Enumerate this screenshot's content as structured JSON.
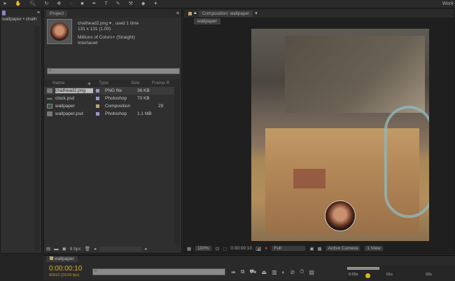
{
  "toolbar": {
    "workspace": "Work"
  },
  "left_panel": {
    "tab": "wallpaper • chath"
  },
  "project": {
    "tab": "Project",
    "info": {
      "name": "chathead2.png ▾ , used 1 time",
      "dims": "131 x 131 (1.00)",
      "colors": "Millions of Colors+ (Straight)",
      "interlace": "Interlaced"
    },
    "search_placeholder": "",
    "columns": {
      "name": "Name",
      "type": "Type",
      "size": "Size",
      "frame": "Frame R"
    },
    "items": [
      {
        "name": "chathead2.png",
        "type": "PNG file",
        "size": "36 KB",
        "frame": ""
      },
      {
        "name": "clock.psd",
        "type": "Photoshop",
        "size": "70 KB",
        "frame": ""
      },
      {
        "name": "wallpaper",
        "type": "Composition",
        "size": "",
        "frame": "29"
      },
      {
        "name": "wallpaper.psd",
        "type": "Photoshop",
        "size": "1.1 MB",
        "frame": ""
      }
    ],
    "bpc": "8 bpc"
  },
  "composition": {
    "tab": "Composition: wallpaper",
    "subtab": "wallpaper",
    "zoom": "100%",
    "timecode": "0:00:00:10",
    "resolution": "Full",
    "camera": "Active Camera",
    "views": "1 View"
  },
  "timeline": {
    "tab": "wallpaper",
    "timecode": "0:00:00:10",
    "frames": "00010 (29.00 fps)",
    "ruler": [
      "0:00s",
      "01s",
      "02s"
    ],
    "playhead_fraction": 0.17
  }
}
